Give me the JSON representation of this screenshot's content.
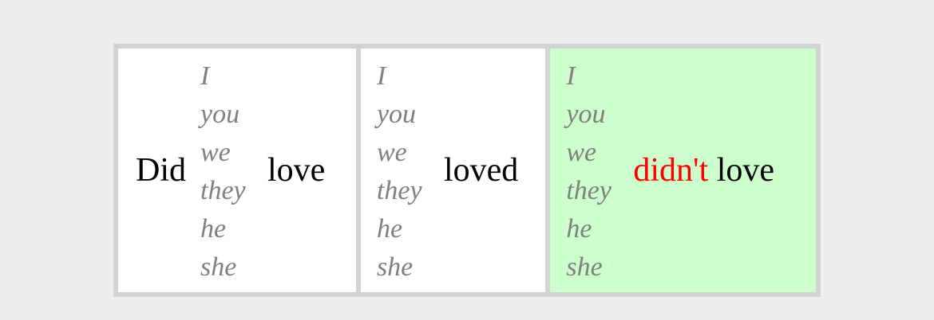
{
  "pronouns": [
    "I",
    "you",
    "we",
    "they",
    "he",
    "she"
  ],
  "cells": [
    {
      "before": "Did",
      "after": "love",
      "highlighted": false
    },
    {
      "before": "",
      "after": "loved",
      "highlighted": false
    },
    {
      "before": "",
      "negation": "didn't",
      "after": "love",
      "highlighted": true
    }
  ],
  "colors": {
    "page_background": "#eeeeee",
    "table_border": "#d3d3d3",
    "cell_background": "#ffffff",
    "highlight_background": "#ccffcc",
    "pronoun_color": "#808080",
    "negation_color": "#ff0000",
    "text_color": "#000000"
  }
}
